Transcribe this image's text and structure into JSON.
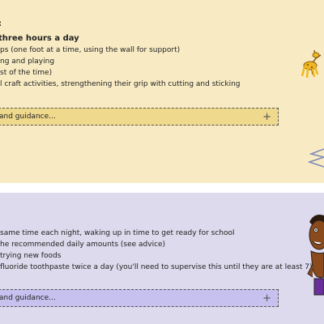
{
  "colors": {
    "section1_bg": "#f8ebc4",
    "section1_accordion_bg": "#efd98d",
    "section2_bg": "#dcdaec",
    "section2_accordion_bg": "#c7c1ef"
  },
  "section1": {
    "heading": "three hours a day",
    "heading_fragment": ":",
    "items": [
      "ps (one foot at a time, using the wall for support)",
      "ng and playing",
      "st of the time)",
      "l craft activities, strengthening their grip with cutting and sticking"
    ],
    "accordion_label": "and guidance...",
    "accordion_icon": "plus-icon"
  },
  "section2": {
    "items": [
      "same time each night, waking up in time to get ready for school",
      "he recommended daily amounts (see advice)",
      "trying new foods",
      "fluoride toothpaste twice a day (you'll need to supervise this until they are at least 7)"
    ],
    "accordion_label": "and guidance...",
    "accordion_icon": "plus-icon"
  }
}
